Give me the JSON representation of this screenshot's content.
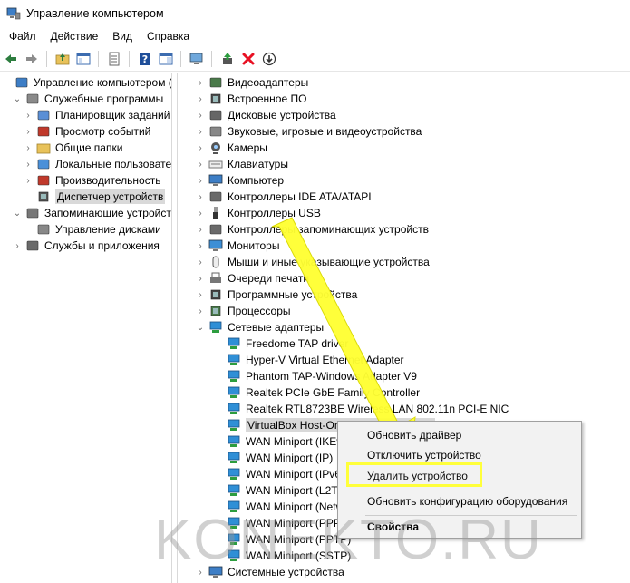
{
  "window": {
    "title": "Управление компьютером"
  },
  "menu": [
    "Файл",
    "Действие",
    "Вид",
    "Справка"
  ],
  "left_tree": [
    {
      "label": "Управление компьютером (л",
      "level": 0,
      "exp": "",
      "icon": "computer-management-icon",
      "selected": false
    },
    {
      "label": "Служебные программы",
      "level": 1,
      "exp": "v",
      "icon": "tools-icon",
      "selected": false
    },
    {
      "label": "Планировщик заданий",
      "level": 2,
      "exp": ">",
      "icon": "task-scheduler-icon",
      "selected": false
    },
    {
      "label": "Просмотр событий",
      "level": 2,
      "exp": ">",
      "icon": "event-viewer-icon",
      "selected": false
    },
    {
      "label": "Общие папки",
      "level": 2,
      "exp": ">",
      "icon": "shared-folders-icon",
      "selected": false
    },
    {
      "label": "Локальные пользовате",
      "level": 2,
      "exp": ">",
      "icon": "local-users-icon",
      "selected": false
    },
    {
      "label": "Производительность",
      "level": 2,
      "exp": ">",
      "icon": "performance-icon",
      "selected": false
    },
    {
      "label": "Диспетчер устройств",
      "level": 2,
      "exp": "",
      "icon": "device-manager-icon",
      "selected": true
    },
    {
      "label": "Запоминающие устройст",
      "level": 1,
      "exp": "v",
      "icon": "storage-icon",
      "selected": false
    },
    {
      "label": "Управление дисками",
      "level": 2,
      "exp": "",
      "icon": "disk-management-icon",
      "selected": false
    },
    {
      "label": "Службы и приложения",
      "level": 1,
      "exp": ">",
      "icon": "services-icon",
      "selected": false
    }
  ],
  "device_tree": [
    {
      "label": "Видеоадаптеры",
      "level": 0,
      "exp": ">",
      "icon": "display-adapter-icon"
    },
    {
      "label": "Встроенное ПО",
      "level": 0,
      "exp": ">",
      "icon": "firmware-icon"
    },
    {
      "label": "Дисковые устройства",
      "level": 0,
      "exp": ">",
      "icon": "disk-drive-icon"
    },
    {
      "label": "Звуковые, игровые и видеоустройства",
      "level": 0,
      "exp": ">",
      "icon": "sound-icon"
    },
    {
      "label": "Камеры",
      "level": 0,
      "exp": ">",
      "icon": "camera-icon"
    },
    {
      "label": "Клавиатуры",
      "level": 0,
      "exp": ">",
      "icon": "keyboard-icon"
    },
    {
      "label": "Компьютер",
      "level": 0,
      "exp": ">",
      "icon": "computer-icon"
    },
    {
      "label": "Контроллеры IDE ATA/ATAPI",
      "level": 0,
      "exp": ">",
      "icon": "ide-controller-icon"
    },
    {
      "label": "Контроллеры USB",
      "level": 0,
      "exp": ">",
      "icon": "usb-icon"
    },
    {
      "label": "Контроллеры запоминающих устройств",
      "level": 0,
      "exp": ">",
      "icon": "storage-controller-icon"
    },
    {
      "label": "Мониторы",
      "level": 0,
      "exp": ">",
      "icon": "monitor-icon"
    },
    {
      "label": "Мыши и иные указывающие устройства",
      "level": 0,
      "exp": ">",
      "icon": "mouse-icon"
    },
    {
      "label": "Очереди печати",
      "level": 0,
      "exp": ">",
      "icon": "printer-icon"
    },
    {
      "label": "Программные устройства",
      "level": 0,
      "exp": ">",
      "icon": "software-device-icon"
    },
    {
      "label": "Процессоры",
      "level": 0,
      "exp": ">",
      "icon": "processor-icon"
    },
    {
      "label": "Сетевые адаптеры",
      "level": 0,
      "exp": "v",
      "icon": "network-adapter-icon"
    },
    {
      "label": "Freedome TAP driver",
      "level": 1,
      "exp": "",
      "icon": "network-adapter-icon"
    },
    {
      "label": "Hyper-V Virtual Ethernet Adapter",
      "level": 1,
      "exp": "",
      "icon": "network-adapter-icon"
    },
    {
      "label": "Phantom TAP-Windows Adapter V9",
      "level": 1,
      "exp": "",
      "icon": "network-adapter-icon"
    },
    {
      "label": "Realtek PCIe GbE Family Controller",
      "level": 1,
      "exp": "",
      "icon": "network-adapter-icon"
    },
    {
      "label": "Realtek RTL8723BE Wireless LAN 802.11n PCI-E NIC",
      "level": 1,
      "exp": "",
      "icon": "network-adapter-icon"
    },
    {
      "label": "VirtualBox Host-Only Ethernet Adapter",
      "level": 1,
      "exp": "",
      "icon": "network-adapter-icon",
      "selected": true
    },
    {
      "label": "WAN Miniport (IKEv2)",
      "level": 1,
      "exp": "",
      "icon": "network-adapter-icon"
    },
    {
      "label": "WAN Miniport (IP)",
      "level": 1,
      "exp": "",
      "icon": "network-adapter-icon"
    },
    {
      "label": "WAN Miniport (IPv6)",
      "level": 1,
      "exp": "",
      "icon": "network-adapter-icon"
    },
    {
      "label": "WAN Miniport (L2TP)",
      "level": 1,
      "exp": "",
      "icon": "network-adapter-icon"
    },
    {
      "label": "WAN Miniport (Network Monitor)",
      "level": 1,
      "exp": "",
      "icon": "network-adapter-icon"
    },
    {
      "label": "WAN Miniport (PPPOE)",
      "level": 1,
      "exp": "",
      "icon": "network-adapter-icon"
    },
    {
      "label": "WAN Miniport (PPTP)",
      "level": 1,
      "exp": "",
      "icon": "network-adapter-icon"
    },
    {
      "label": "WAN Miniport (SSTP)",
      "level": 1,
      "exp": "",
      "icon": "network-adapter-icon"
    },
    {
      "label": "Системные устройства",
      "level": 0,
      "exp": ">",
      "icon": "system-device-icon"
    }
  ],
  "context_menu": [
    {
      "label": "Обновить драйвер",
      "bold": false
    },
    {
      "label": "Отключить устройство",
      "bold": false
    },
    {
      "label": "Удалить устройство",
      "bold": false,
      "highlighted": true
    },
    {
      "label": "Обновить конфигурацию оборудования",
      "bold": false
    },
    {
      "label": "Свойства",
      "bold": true
    }
  ],
  "annotation": {
    "arrow_color": "#ffff33",
    "highlight_color": "#ffff3a"
  },
  "watermark": "KONEKTO.RU",
  "colors": {
    "selection": "#d9d9d9",
    "menu_bg": "#f2f2f2",
    "delete_icon": "#e81123",
    "help_icon": "#1f4e99"
  }
}
